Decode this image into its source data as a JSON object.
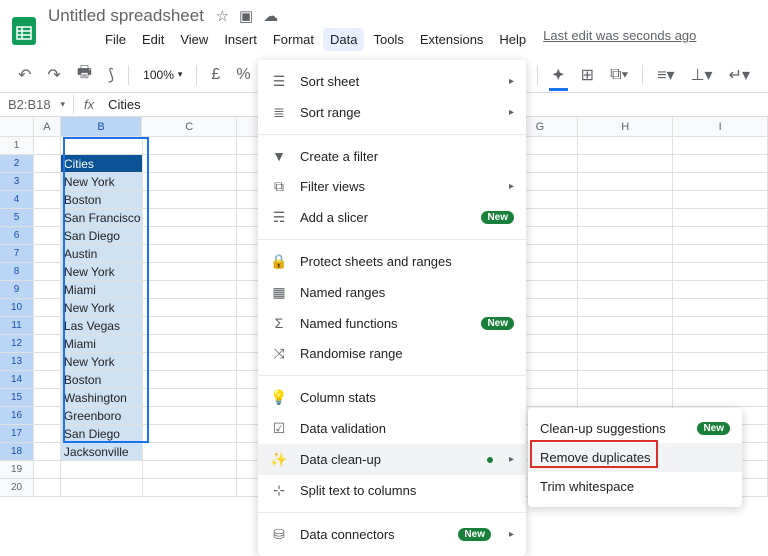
{
  "doc_title": "Untitled spreadsheet",
  "last_edit": "Last edit was seconds ago",
  "menubar": [
    "File",
    "Edit",
    "View",
    "Insert",
    "Format",
    "Data",
    "Tools",
    "Extensions",
    "Help"
  ],
  "active_menu": "Data",
  "toolbar": {
    "zoom": "100%",
    "currency": "£",
    "percent": "%"
  },
  "formula_bar": {
    "ref": "B2:B18",
    "value": "Cities"
  },
  "columns": [
    "A",
    "B",
    "C",
    "G",
    "H",
    "I"
  ],
  "rows": [
    {
      "n": 1,
      "b": ""
    },
    {
      "n": 2,
      "b": "Cities",
      "hdr": true
    },
    {
      "n": 3,
      "b": "New York"
    },
    {
      "n": 4,
      "b": "Boston"
    },
    {
      "n": 5,
      "b": "San Francisco"
    },
    {
      "n": 6,
      "b": "San Diego"
    },
    {
      "n": 7,
      "b": "Austin"
    },
    {
      "n": 8,
      "b": "New York"
    },
    {
      "n": 9,
      "b": "Miami"
    },
    {
      "n": 10,
      "b": "New York"
    },
    {
      "n": 11,
      "b": "Las Vegas"
    },
    {
      "n": 12,
      "b": "Miami"
    },
    {
      "n": 13,
      "b": "New York"
    },
    {
      "n": 14,
      "b": "Boston"
    },
    {
      "n": 15,
      "b": "Washington"
    },
    {
      "n": 16,
      "b": "Greenboro"
    },
    {
      "n": 17,
      "b": "San Diego"
    },
    {
      "n": 18,
      "b": "Jacksonville"
    },
    {
      "n": 19,
      "b": ""
    },
    {
      "n": 20,
      "b": ""
    }
  ],
  "data_menu": {
    "sort_sheet": "Sort sheet",
    "sort_range": "Sort range",
    "create_filter": "Create a filter",
    "filter_views": "Filter views",
    "add_slicer": "Add a slicer",
    "protect": "Protect sheets and ranges",
    "named_ranges": "Named ranges",
    "named_functions": "Named functions",
    "randomise": "Randomise range",
    "column_stats": "Column stats",
    "data_validation": "Data validation",
    "data_cleanup": "Data clean-up",
    "split_text": "Split text to columns",
    "data_connectors": "Data connectors",
    "new": "New"
  },
  "submenu": {
    "cleanup_suggestions": "Clean-up suggestions",
    "remove_duplicates": "Remove duplicates",
    "trim_whitespace": "Trim whitespace",
    "new": "New"
  }
}
